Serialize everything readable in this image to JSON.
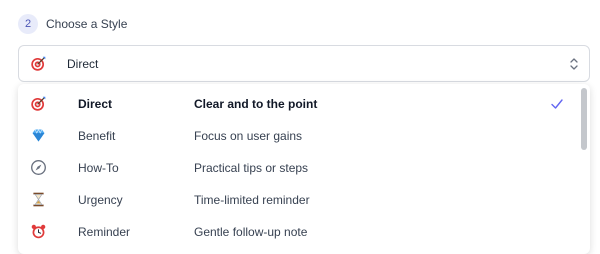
{
  "step": {
    "number": "2",
    "title": "Choose a Style"
  },
  "select": {
    "value": "Direct",
    "icon": "dart-target-icon"
  },
  "options": [
    {
      "name": "Direct",
      "description": "Clear and to the point",
      "icon": "dart-target-icon",
      "selected": true
    },
    {
      "name": "Benefit",
      "description": "Focus on user gains",
      "icon": "gem-icon",
      "selected": false
    },
    {
      "name": "How-To",
      "description": "Practical tips or steps",
      "icon": "compass-icon",
      "selected": false
    },
    {
      "name": "Urgency",
      "description": "Time-limited reminder",
      "icon": "hourglass-icon",
      "selected": false
    },
    {
      "name": "Reminder",
      "description": "Gentle follow-up note",
      "icon": "alarm-clock-icon",
      "selected": false
    }
  ],
  "colors": {
    "accent": "#4b55b5",
    "check": "#6366f1",
    "border": "#d8dbe1"
  }
}
